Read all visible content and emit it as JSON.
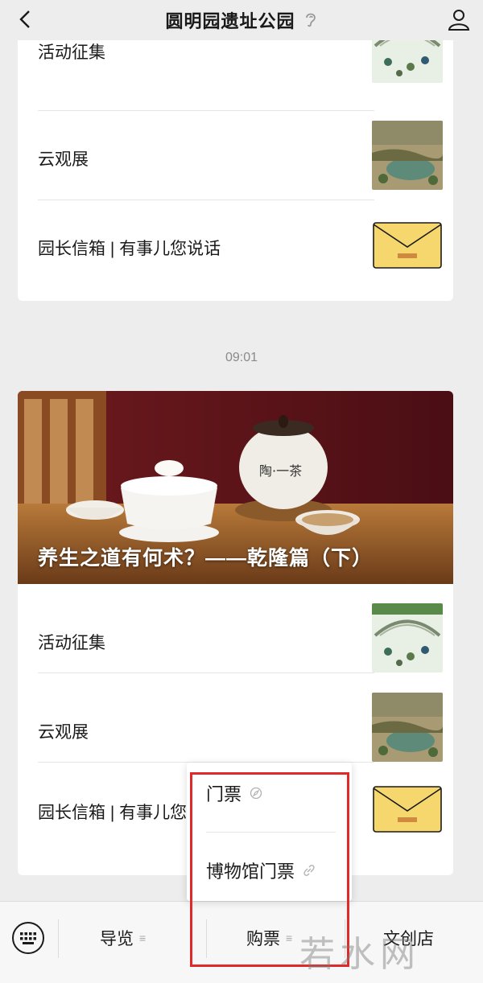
{
  "header": {
    "title": "圆明园遗址公园",
    "back_icon": "chevron-left-icon",
    "ear_icon": "ear-icon",
    "profile_icon": "person-icon"
  },
  "card1": {
    "items": [
      {
        "label": "活动征集",
        "thumb": "bridge-painting"
      },
      {
        "label": "云观展",
        "thumb": "landscape-painting"
      },
      {
        "label": "园长信箱 | 有事儿您说话",
        "thumb": "envelope"
      }
    ]
  },
  "timestamp": "09:01",
  "card2": {
    "banner_title": "养生之道有何术？——乾隆篇（下）",
    "items": [
      {
        "label": "活动征集",
        "thumb": "bridge-painting"
      },
      {
        "label": "云观展",
        "thumb": "landscape-painting"
      },
      {
        "label": "园长信箱 | 有事儿您说话",
        "thumb": "envelope"
      }
    ]
  },
  "bottom_menu": {
    "keyboard_icon": "keyboard-icon",
    "tabs": [
      {
        "label": "导览"
      },
      {
        "label": "购票"
      },
      {
        "label": "文创店"
      }
    ]
  },
  "popup": {
    "items": [
      {
        "label": "门票",
        "icon": "compass-icon"
      },
      {
        "label": "博物馆门票",
        "icon": "link-icon"
      }
    ]
  },
  "watermark": "若水网",
  "colors": {
    "background": "#ededed",
    "card": "#ffffff",
    "highlight_border": "#e02a2a",
    "envelope": "#f5d76e"
  }
}
